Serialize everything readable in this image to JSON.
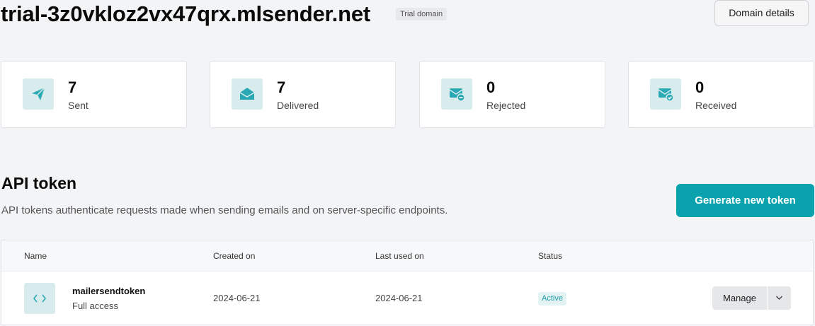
{
  "header": {
    "domain": "trial-3z0vkloz2vx47qrx.mlsender.net",
    "badge": "Trial domain",
    "details_button": "Domain details"
  },
  "stats": [
    {
      "value": "7",
      "label": "Sent",
      "icon": "paper-plane-icon"
    },
    {
      "value": "7",
      "label": "Delivered",
      "icon": "open-envelope-icon"
    },
    {
      "value": "0",
      "label": "Rejected",
      "icon": "mail-minus-icon"
    },
    {
      "value": "0",
      "label": "Received",
      "icon": "mail-check-icon"
    }
  ],
  "api": {
    "title": "API token",
    "description": "API tokens authenticate requests made when sending emails and on server-specific endpoints.",
    "generate_button": "Generate new token"
  },
  "table": {
    "headers": [
      "Name",
      "Created on",
      "Last used on",
      "Status"
    ],
    "rows": [
      {
        "name": "mailersendtoken",
        "access": "Full access",
        "created": "2024-06-21",
        "last_used": "2024-06-21",
        "status": "Active",
        "manage": "Manage",
        "icon": "code-icon"
      }
    ]
  },
  "colors": {
    "accent": "#0aa2ad",
    "icon_bg": "#d8ecee",
    "icon_fg": "#2aa8b3"
  }
}
